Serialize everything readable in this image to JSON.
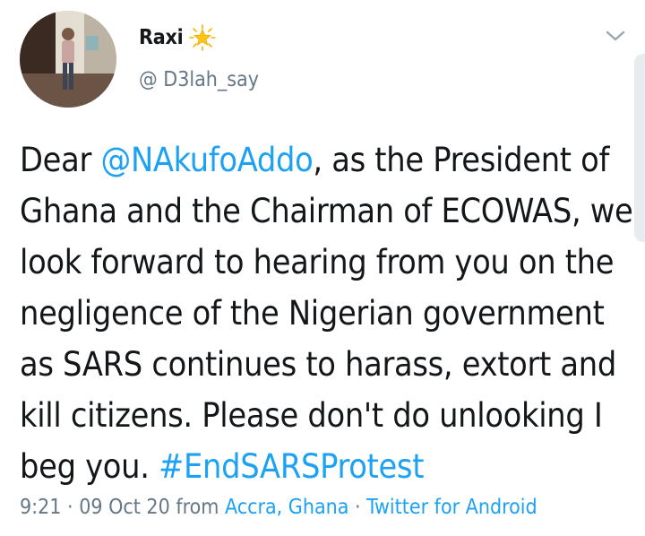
{
  "author": {
    "display_name": "Raxi",
    "badge_icon": "star-emoji-icon",
    "handle": "@ D3lah_say"
  },
  "menu_icon": "chevron-down-icon",
  "tweet": {
    "line1": {
      "pre": "Dear ",
      "mention": "@NAkufoAddo",
      "post": ", as the President of"
    },
    "line2": "Ghana and the Chairman of ECOWAS, we",
    "line3": "look forward to hearing from you on the",
    "line4": "negligence of the Nigerian government",
    "line5": "as SARS continues to harass, extort and",
    "line6": "kill citizens. Please don't do unlooking I",
    "line7": {
      "pre": "beg you. ",
      "hashtag": "#EndSARSProtest"
    }
  },
  "meta": {
    "time": "9:21",
    "sep1": " · ",
    "date": "09 Oct 20",
    "from": " from ",
    "location": "Accra, Ghana",
    "sep2": " · ",
    "client": "Twitter for Android"
  },
  "colors": {
    "link": "#1da1f2",
    "text": "#14171a",
    "muted": "#657786"
  }
}
